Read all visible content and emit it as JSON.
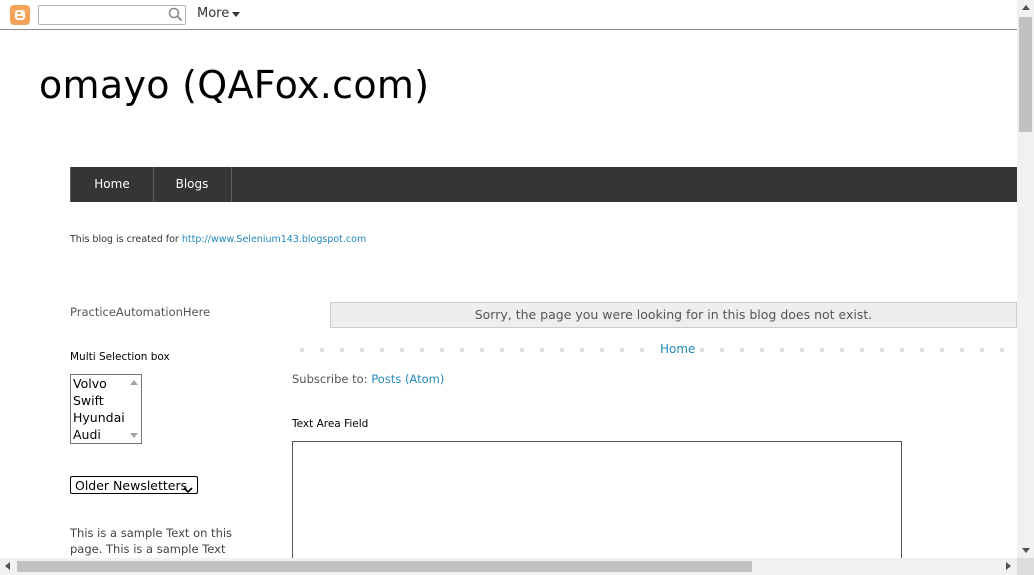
{
  "navbar": {
    "logo": "blogger-logo-icon",
    "search_placeholder": "",
    "more_label": "More"
  },
  "blog": {
    "title": "omayo (QAFox.com)"
  },
  "tabs": [
    {
      "label": "Home"
    },
    {
      "label": "Blogs"
    }
  ],
  "description": {
    "prefix": "This blog is created for ",
    "link": "http://www.Selenium143.blogspot.com"
  },
  "sidebar": {
    "label": "PracticeAutomationHere",
    "multiselect_heading": "Multi Selection box",
    "multiselect_options": [
      "Volvo",
      "Swift",
      "Hyundai",
      "Audi"
    ],
    "newsletter_selected": "Older Newsletters",
    "sample_text": "This is a sample Text on this page. This is a sample Text on"
  },
  "main": {
    "status_message": "Sorry, the page you were looking for in this blog does not exist.",
    "home_link": "Home",
    "subscribe_prefix": "Subscribe to: ",
    "subscribe_link": "Posts (Atom)",
    "textarea_heading": "Text Area Field",
    "textarea_value": ""
  },
  "colors": {
    "link": "#2288bb",
    "tabs_bg": "#353535",
    "blogger_orange": "#f5a35a"
  }
}
